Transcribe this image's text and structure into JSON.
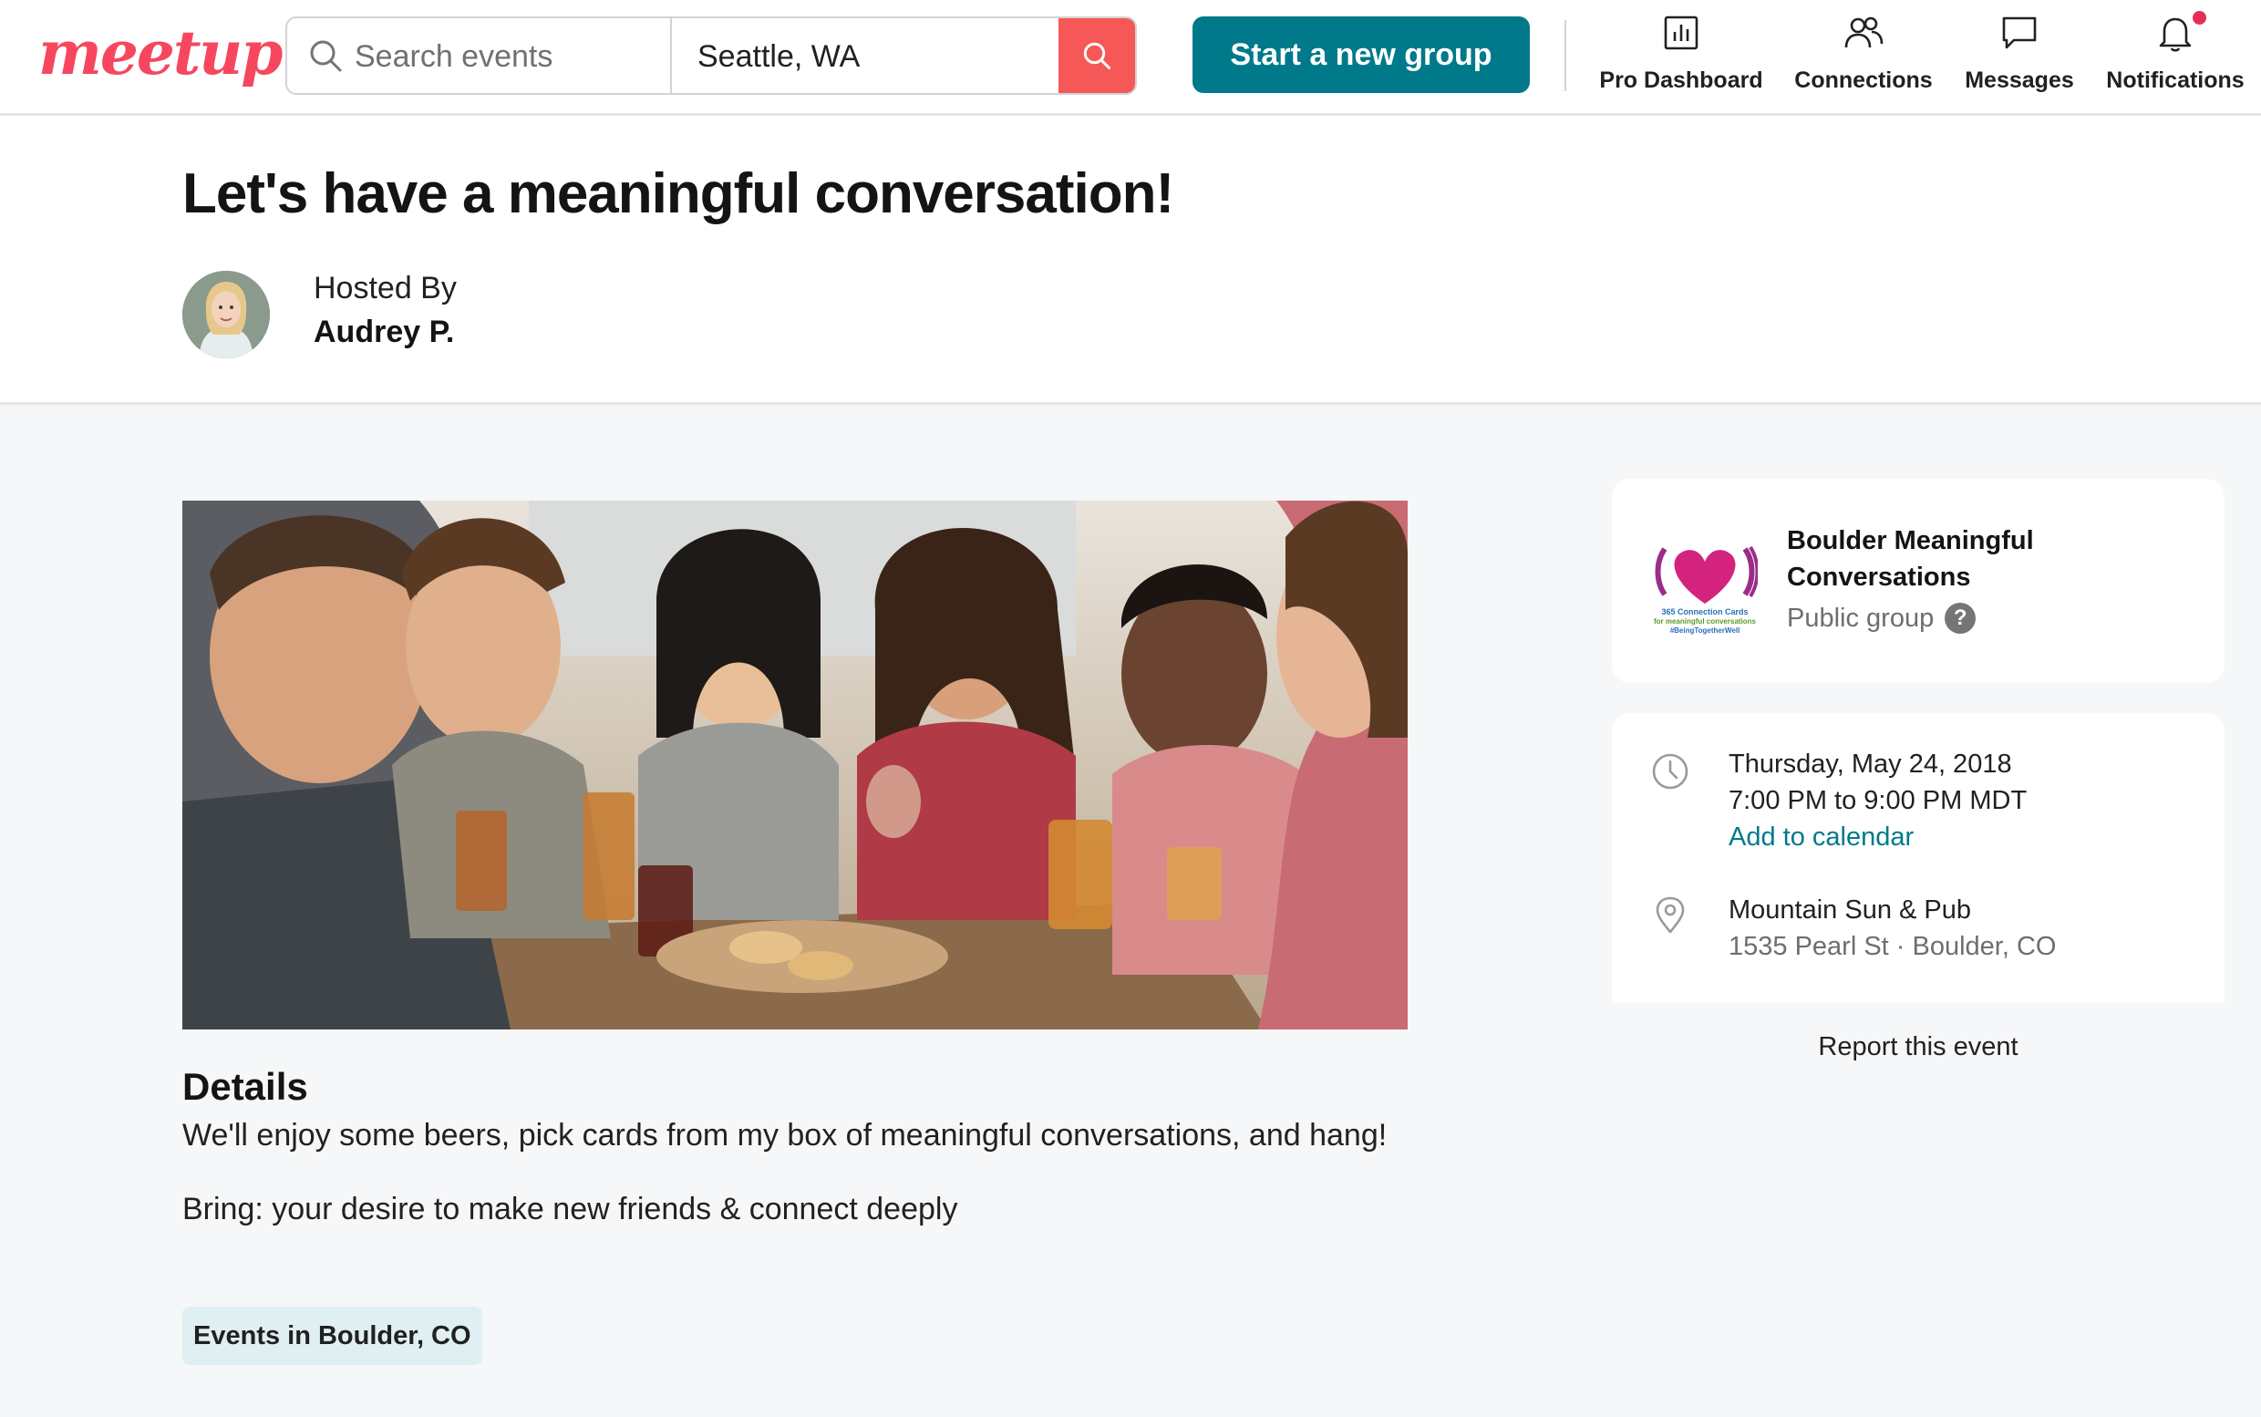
{
  "header": {
    "logo_text": "meetup",
    "search": {
      "events_placeholder": "Search events",
      "location_value": "Seattle, WA"
    },
    "start_group_label": "Start a new group",
    "nav": {
      "pro_dashboard": "Pro Dashboard",
      "connections": "Connections",
      "messages": "Messages",
      "notifications": "Notifications"
    },
    "brand_color": "#f6475f",
    "accent_color": "#00798a"
  },
  "event": {
    "title": "Let's have a meaningful conversation!",
    "hosted_by_label": "Hosted By",
    "host_name": "Audrey P."
  },
  "details": {
    "heading": "Details",
    "paragraph_1": "We'll enjoy some beers, pick cards from my box of meaningful conversations, and hang!",
    "paragraph_2": "Bring: your desire to make new friends & connect deeply"
  },
  "topic_chip": "Events in Boulder, CO",
  "group": {
    "name": "Boulder Meaningful Conversations",
    "type": "Public group",
    "help_symbol": "?",
    "logo_text": [
      "365 Connection Cards",
      "for meaningful conversations",
      "#BeingTogetherWell"
    ]
  },
  "info": {
    "date": "Thursday, May 24, 2018",
    "time": "7:00 PM to 9:00 PM MDT",
    "add_to_calendar": "Add to calendar",
    "venue_name": "Mountain Sun & Pub",
    "venue_address": "1535 Pearl St · Boulder, CO"
  },
  "report_label": "Report this event"
}
